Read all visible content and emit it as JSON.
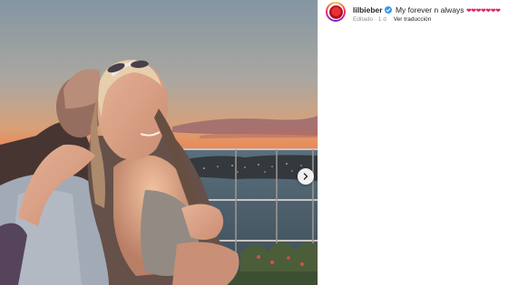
{
  "post": {
    "username": "lilbieber",
    "caption": "My forever n always",
    "hearts": "❤❤❤❤❤❤❤",
    "edited_label": "Editado",
    "separator": "·",
    "age": "1 d",
    "translate_label": "Ver traducción"
  },
  "icons": {
    "verified": "verified-badge-icon",
    "next": "chevron-right-icon"
  },
  "colors": {
    "sky_top": "#7a93a3",
    "sunset_orange": "#e58a53",
    "sea": "#3c5868",
    "verified_blue": "#3897f0",
    "heart_red": "#e0245e"
  }
}
